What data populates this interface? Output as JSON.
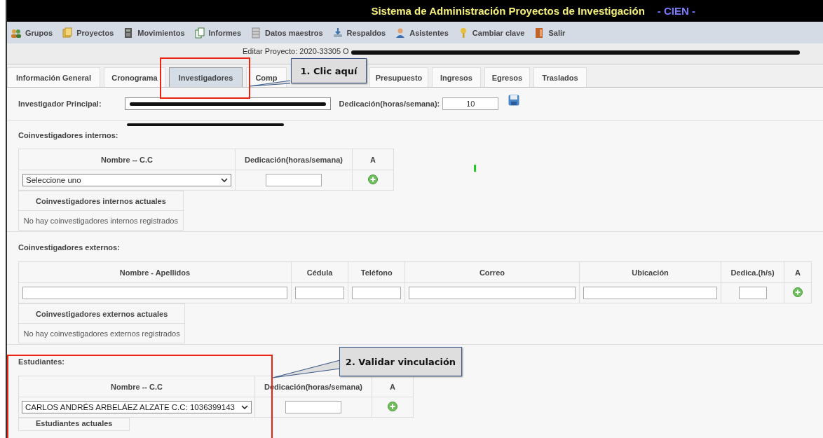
{
  "header": {
    "title": "Sistema de Administración Proyectos de Investigación",
    "badge": "- CIEN -"
  },
  "menu": [
    {
      "label": "Grupos"
    },
    {
      "label": "Proyectos"
    },
    {
      "label": "Movimientos"
    },
    {
      "label": "Informes"
    },
    {
      "label": "Datos maestros"
    },
    {
      "label": "Respaldos"
    },
    {
      "label": "Asistentes"
    },
    {
      "label": "Cambiar clave"
    },
    {
      "label": "Salir"
    }
  ],
  "project_line": "Editar Proyecto: 2020-33305 O",
  "tabs": [
    {
      "label": "Información General",
      "selected": false
    },
    {
      "label": "Cronograma",
      "selected": false
    },
    {
      "label": "Investigadores",
      "selected": true
    },
    {
      "label": "Comp",
      "selected": false
    },
    {
      "label": "Presupuesto",
      "selected": false
    },
    {
      "label": "Ingresos",
      "selected": false
    },
    {
      "label": "Egresos",
      "selected": false
    },
    {
      "label": "Traslados",
      "selected": false
    }
  ],
  "principal": {
    "label": "Investigador Principal:",
    "dedication_label": "Dedicación(horas/semana):",
    "dedication_value": "10"
  },
  "internal": {
    "title": "Coinvestigadores internos:",
    "columns": [
      "Nombre -- C.C",
      "Dedicación(horas/semana)",
      "A"
    ],
    "select_value": "Seleccione uno",
    "current_title": "Coinvestigadores internos actuales",
    "empty": "No hay coinvestigadores internos registrados"
  },
  "external": {
    "title": "Coinvestigadores externos:",
    "columns": [
      "Nombre - Apellidos",
      "Cédula",
      "Teléfono",
      "Correo",
      "Ubicación",
      "Dedica.(h/s)",
      "A"
    ],
    "current_title": "Coinvestigadores externos actuales",
    "empty": "No hay coinvestigadores externos registrados"
  },
  "students": {
    "title": "Estudiantes:",
    "columns": [
      "Nombre -- C.C",
      "Dedicación(horas/semana)",
      "A"
    ],
    "select_value": "CARLOS ANDRÉS ARBELÁEZ ALZATE C.C: 1036399143",
    "current_title": "Estudiantes actuales"
  },
  "callouts": [
    {
      "text": "1. Clic aquí"
    },
    {
      "text": "2. Validar vinculación"
    }
  ]
}
